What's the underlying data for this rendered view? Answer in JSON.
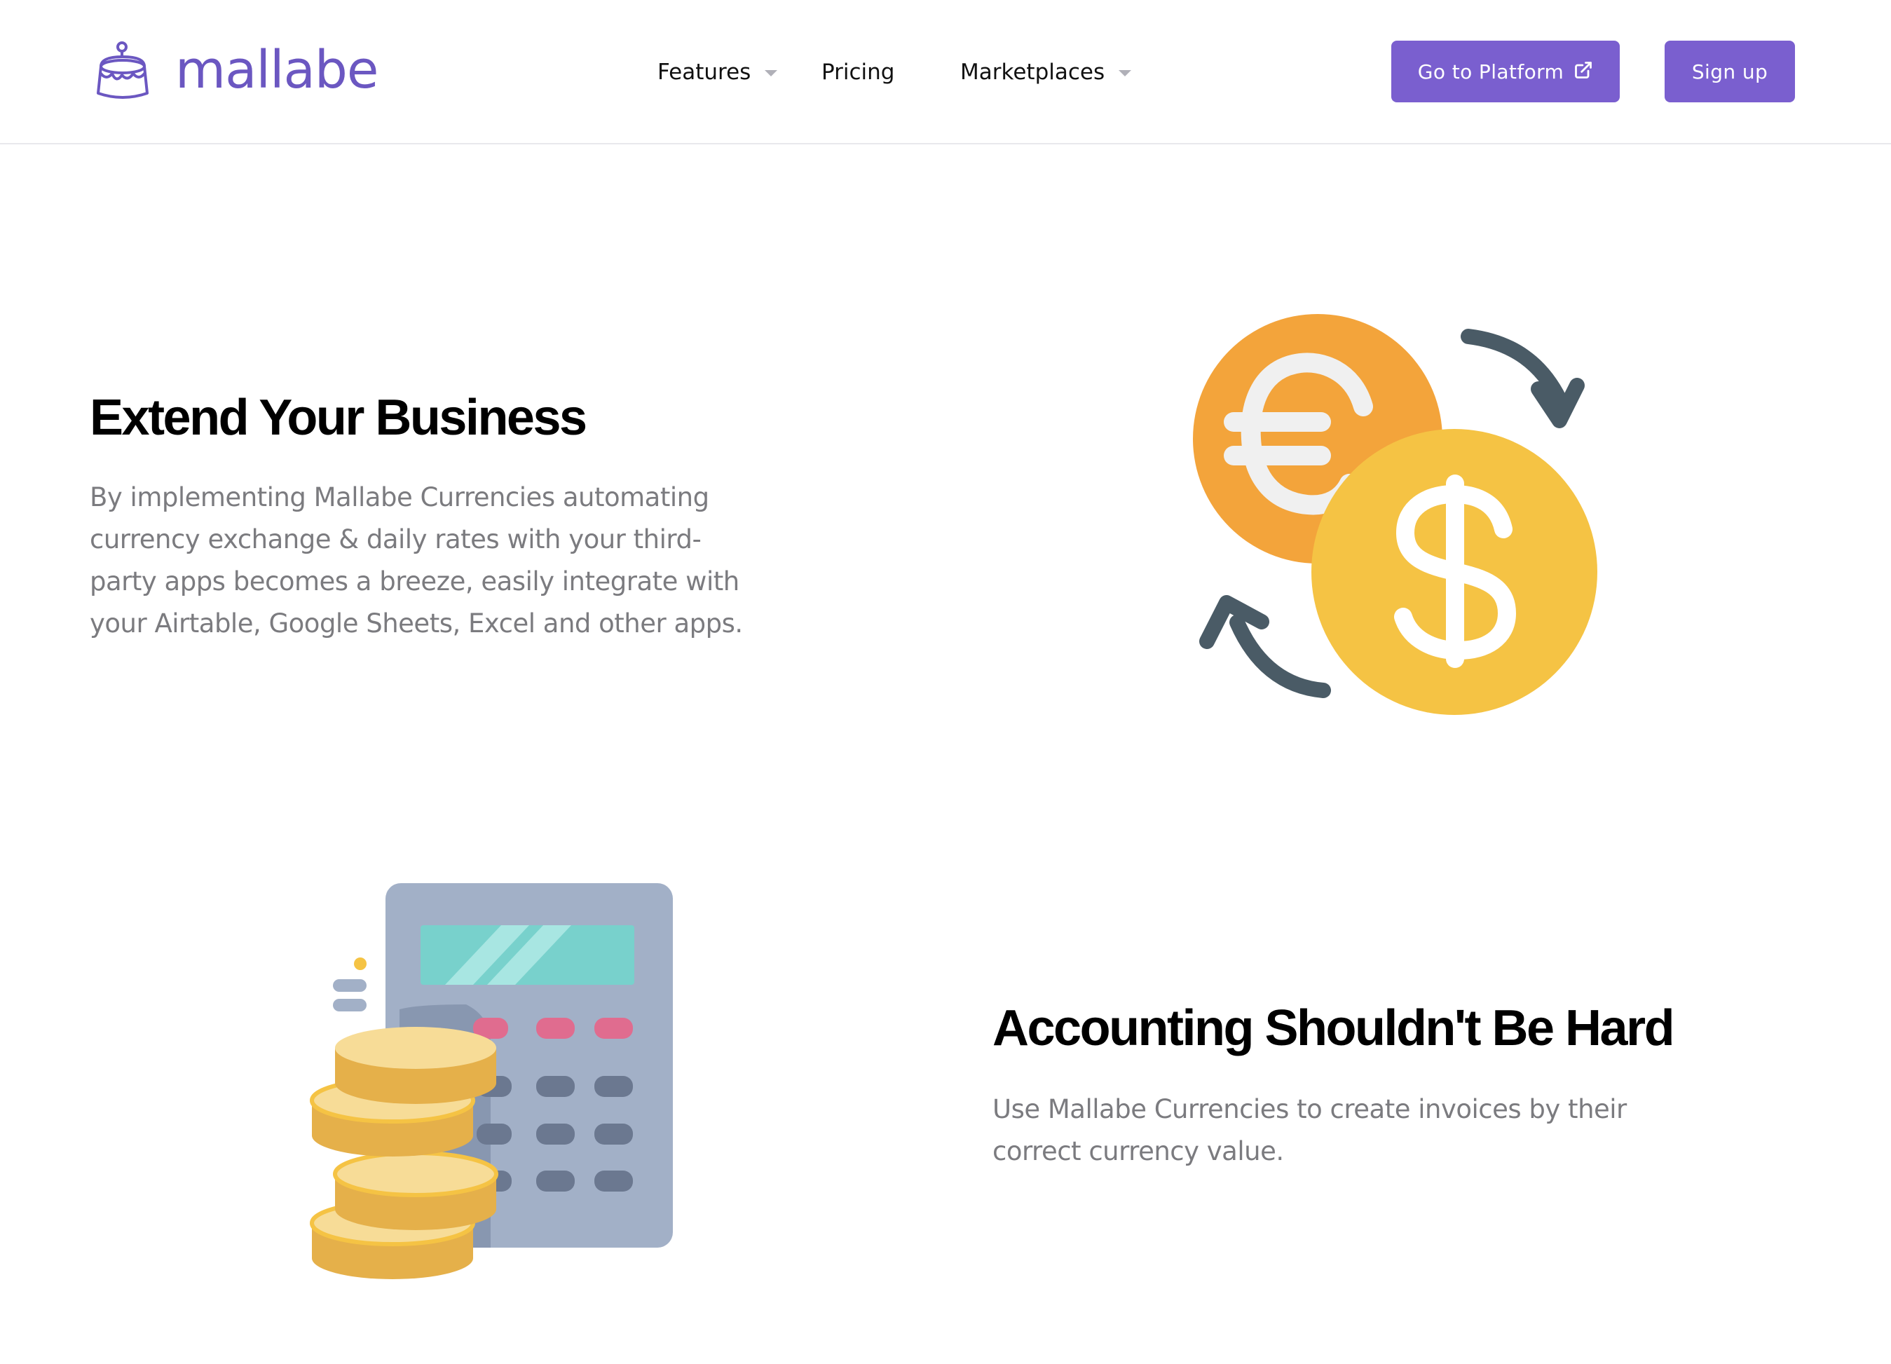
{
  "brand": {
    "name": "mallabe",
    "color": "#6b57c1",
    "icon": "cake-icon"
  },
  "nav": {
    "items": [
      {
        "label": "Features",
        "has_dropdown": true
      },
      {
        "label": "Pricing",
        "has_dropdown": false
      },
      {
        "label": "Marketplaces",
        "has_dropdown": true
      }
    ]
  },
  "header_buttons": {
    "platform_label": "Go to Platform",
    "platform_icon": "external-link-icon",
    "signup_label": "Sign up",
    "color": "#7a5fcf"
  },
  "sections": [
    {
      "title": "Extend Your Business",
      "body": "By implementing Mallabe Currencies automating currency exchange & daily rates with your third-party apps becomes a breeze, easily integrate with your Airtable, Google Sheets, Excel and other apps.",
      "illustration": "currency-exchange-icon"
    },
    {
      "title": "Accounting Shouldn't Be Hard",
      "body": "Use Mallabe Currencies to create invoices by their correct currency value.",
      "illustration": "calculator-coins-icon"
    }
  ]
}
